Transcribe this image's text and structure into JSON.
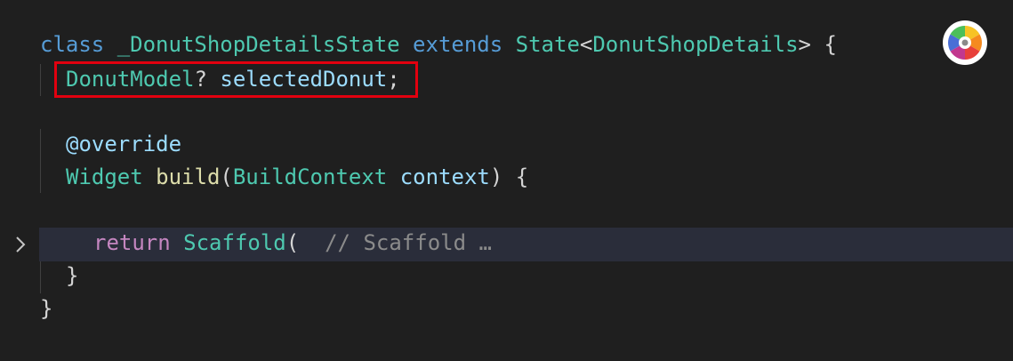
{
  "editor": {
    "line1": {
      "kw1": "class",
      "cls": "_DonutShopDetailsState",
      "kw2": "extends",
      "base": "State",
      "lt": "<",
      "generic": "DonutShopDetails",
      "gt_brace": "> {"
    },
    "line2": {
      "type": "DonutModel",
      "q": "?",
      "var": "selectedDonut",
      "semi": ";"
    },
    "line3": {
      "annotation": "@override"
    },
    "line4": {
      "type": "Widget",
      "fn": "build",
      "paren_open": "(",
      "param_type": "BuildContext",
      "param_name": "context",
      "paren_close": ")",
      "brace": "{"
    },
    "line5": {
      "kw": "return",
      "type": "Scaffold",
      "paren": "(",
      "comment": "// Scaffold",
      "ellipsis": "…"
    },
    "line6": {
      "brace": "}"
    },
    "line7": {
      "brace": "}"
    }
  },
  "colors": {
    "background": "#1f1f1f",
    "keyword": "#569cd6",
    "type": "#4ec9b0",
    "variable": "#9cdcfe",
    "function": "#dcdcaa",
    "control": "#c586c0",
    "comment": "#8b8b8b",
    "highlight_box": "#e2000f",
    "folded_line_bg": "#2a2d3a"
  },
  "icons": {
    "fold": "chevron-right-icon",
    "extension": "color-wheel-icon"
  }
}
